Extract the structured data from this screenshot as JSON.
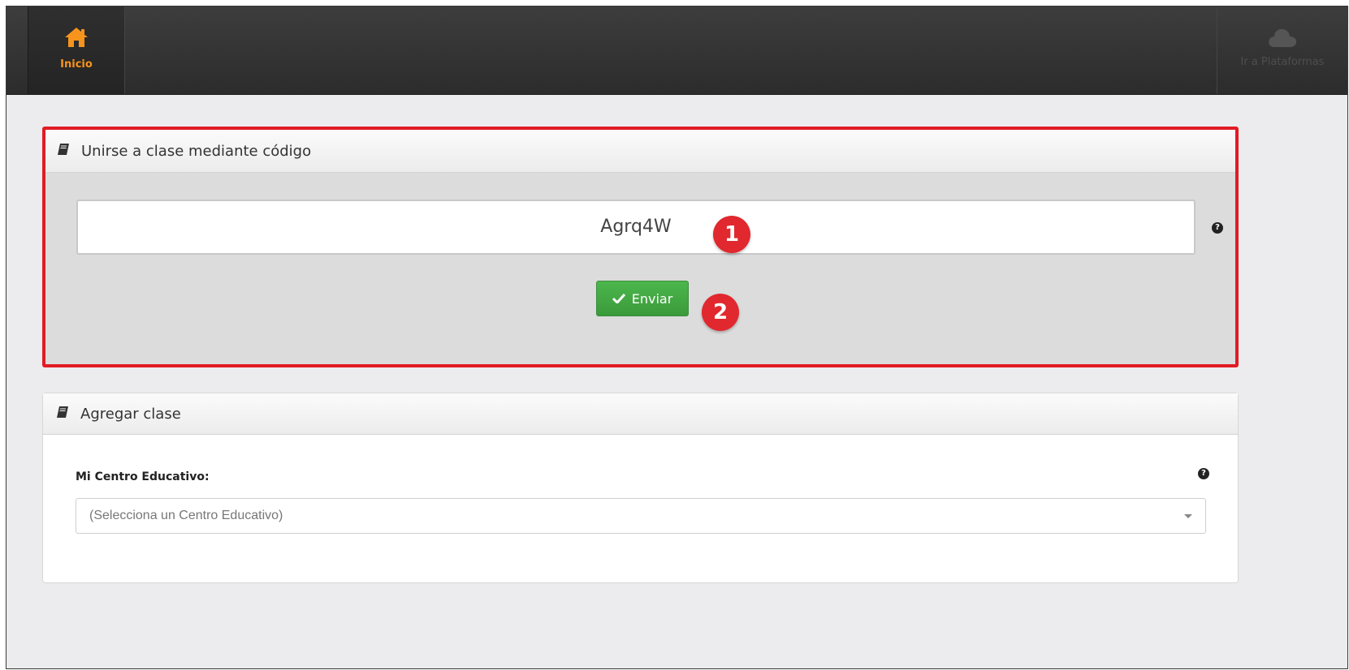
{
  "nav": {
    "home_label": "Inicio",
    "home_icon": "home-icon",
    "platforms_label": "Ir a Plataformas",
    "platforms_icon": "cloud-icon",
    "accent_color": "#f7941d"
  },
  "join_panel": {
    "title": "Unirse a clase mediante código",
    "icon": "book-icon",
    "code_value": "Agrq4W",
    "send_label": "Enviar",
    "help": "?",
    "highlight_color": "#e21b24"
  },
  "annotations": {
    "step1": "1",
    "step2": "2"
  },
  "add_panel": {
    "title": "Agregar clase",
    "icon": "book-icon",
    "school_label": "Mi Centro Educativo:",
    "school_placeholder": "(Selecciona un Centro Educativo)",
    "help": "?"
  }
}
